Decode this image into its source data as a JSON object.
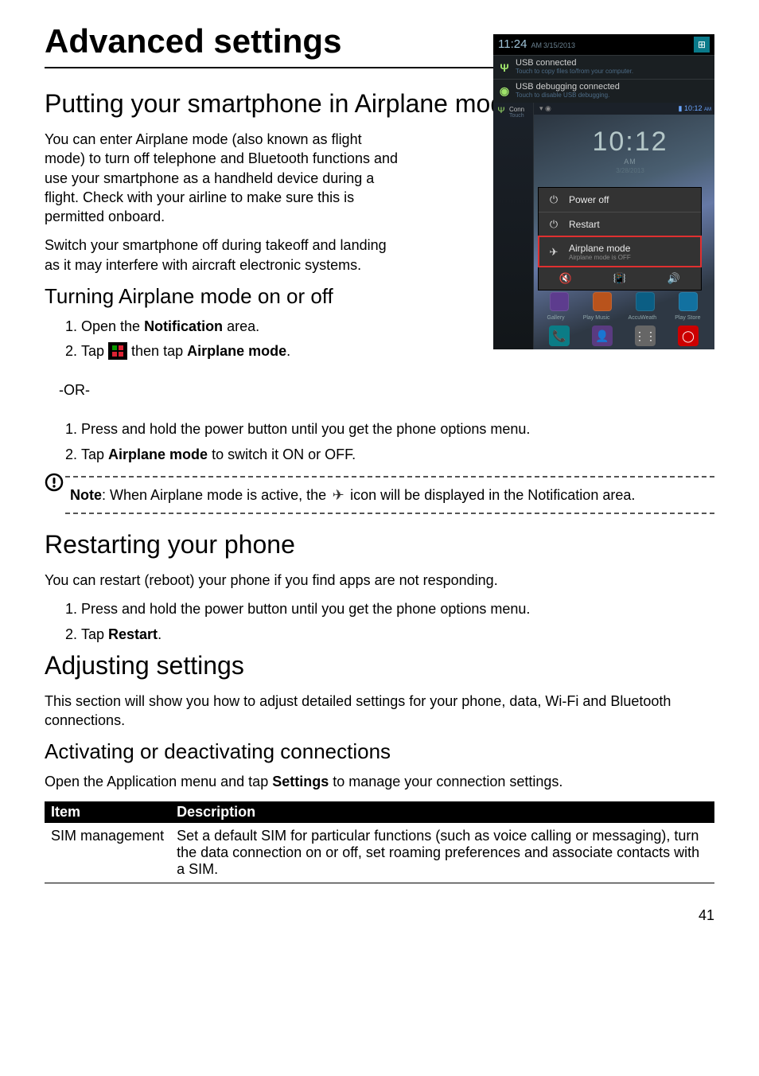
{
  "chapter_title": "Advanced settings",
  "section1": {
    "title": "Putting your smartphone in Airplane mode",
    "p1": "You can enter Airplane mode (also known as flight mode) to turn off telephone and Bluetooth functions and use your smartphone as a handheld device during a flight. Check with your airline to make sure this is permitted onboard.",
    "p2": "Switch your smartphone off during takeoff and landing as it may interfere with aircraft electronic systems."
  },
  "section1a": {
    "title": "Turning Airplane mode on or off",
    "step1_pre": "Open the ",
    "step1_bold": "Notification",
    "step1_post": " area.",
    "step2_pre": "Tap ",
    "step2_mid": " then tap ",
    "step2_bold": "Airplane mode",
    "step2_post": ".",
    "or": "-OR-",
    "alt_step1": "Press and hold the power button until you get the phone options menu.",
    "alt_step2_pre": "Tap ",
    "alt_step2_bold": "Airplane mode",
    "alt_step2_post": " to switch it ON or OFF.",
    "note_bold": "Note",
    "note_mid": ": When Airplane mode is active, the ",
    "note_post": " icon will be displayed in the Notification area."
  },
  "section2": {
    "title": "Restarting your phone",
    "p1": "You can restart (reboot) your phone if you find apps are not responding.",
    "step1": "Press and hold the power button until you get the phone options menu.",
    "step2_pre": "Tap ",
    "step2_bold": "Restart",
    "step2_post": "."
  },
  "section3": {
    "title": "Adjusting settings",
    "p1": "This section will show you how to adjust detailed settings for your phone, data, Wi-Fi and Bluetooth connections."
  },
  "section3a": {
    "title": "Activating or deactivating connections",
    "p1_pre": "Open the Application menu and tap ",
    "p1_bold": "Settings",
    "p1_post": " to manage your connection settings.",
    "th1": "Item",
    "th2": "Description",
    "row1_item": "SIM management",
    "row1_desc": "Set a default SIM for particular functions (such as voice calling or messaging), turn the data connection on or off, set roaming preferences and associate contacts with a SIM."
  },
  "figure": {
    "clock": "11:24",
    "ampm": "AM",
    "date": "3/15/2013",
    "qs_icon": "⊞",
    "notif1_title": "USB connected",
    "notif1_sub": "Touch to copy files to/from your computer.",
    "notif2_title": "USB debugging connected",
    "notif2_sub": "Touch to disable USB debugging.",
    "left_conn": "Conn",
    "left_touch": "Touch",
    "wall_time": "10:12",
    "wall_ampm": "AM",
    "wall_time_small": "10:12",
    "wall_date": "3/28/2013",
    "menu_poweroff": "Power off",
    "menu_restart": "Restart",
    "menu_airplane": "Airplane mode",
    "menu_airplane_sub": "Airplane mode is OFF",
    "app1": "Gallery",
    "app2": "Play Music",
    "app3": "AccuWeath",
    "app4": "Play Store"
  },
  "page_number": "41"
}
